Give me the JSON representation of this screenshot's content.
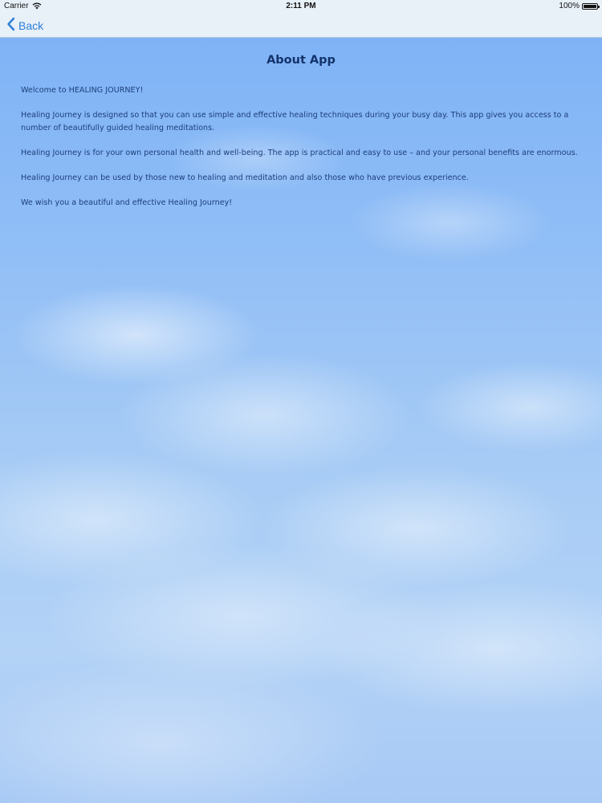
{
  "status_bar": {
    "carrier": "Carrier",
    "time": "2:11 PM",
    "battery": "100%"
  },
  "nav": {
    "back_label": "Back"
  },
  "page": {
    "title": "About App",
    "paragraphs": [
      "Welcome to HEALING JOURNEY!",
      "Healing Journey is designed so that you can use simple and effective healing techniques during your busy day. This app gives you access to a number of beautifully guided healing meditations.",
      "Healing Journey is for your own personal health and well-being. The app is practical and easy to use – and your personal benefits are enormous.",
      "Healing Journey can be used by those new to healing and meditation and also those who have previous experience.",
      "We wish you a beautiful and effective Healing Journey!"
    ]
  },
  "icons": {
    "wifi": "wifi-icon",
    "battery": "battery-icon",
    "back": "chevron-left-icon"
  },
  "colors": {
    "accent": "#2b7fd6",
    "title": "#14336b",
    "text": "#1c3f7a",
    "nav_background": "#e8f0f8",
    "sky_top": "#7fb3f6",
    "sky_bottom": "#a7c9f5"
  }
}
